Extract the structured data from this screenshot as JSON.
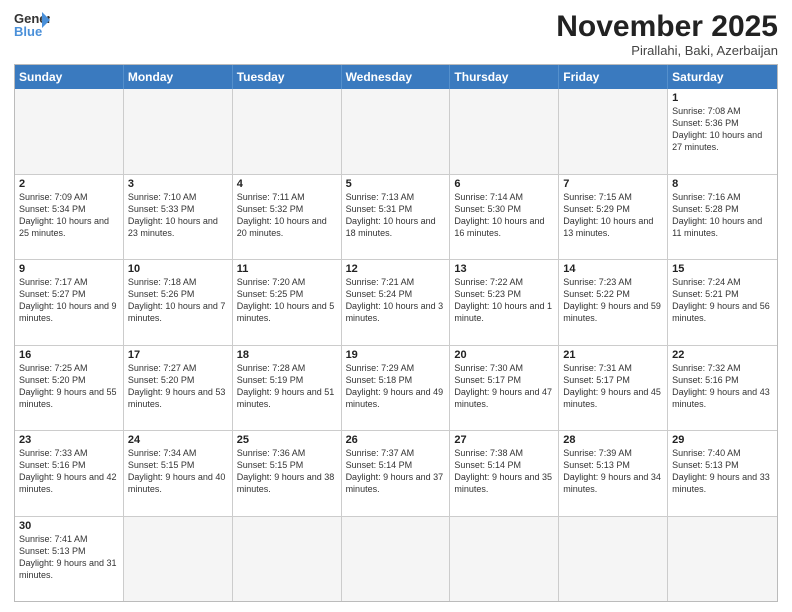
{
  "header": {
    "logo_general": "General",
    "logo_blue": "Blue",
    "month_title": "November 2025",
    "location": "Pirallahi, Baki, Azerbaijan"
  },
  "weekdays": [
    "Sunday",
    "Monday",
    "Tuesday",
    "Wednesday",
    "Thursday",
    "Friday",
    "Saturday"
  ],
  "rows": [
    [
      {
        "day": "",
        "info": ""
      },
      {
        "day": "",
        "info": ""
      },
      {
        "day": "",
        "info": ""
      },
      {
        "day": "",
        "info": ""
      },
      {
        "day": "",
        "info": ""
      },
      {
        "day": "",
        "info": ""
      },
      {
        "day": "1",
        "info": "Sunrise: 7:08 AM\nSunset: 5:36 PM\nDaylight: 10 hours and 27 minutes."
      }
    ],
    [
      {
        "day": "2",
        "info": "Sunrise: 7:09 AM\nSunset: 5:34 PM\nDaylight: 10 hours and 25 minutes."
      },
      {
        "day": "3",
        "info": "Sunrise: 7:10 AM\nSunset: 5:33 PM\nDaylight: 10 hours and 23 minutes."
      },
      {
        "day": "4",
        "info": "Sunrise: 7:11 AM\nSunset: 5:32 PM\nDaylight: 10 hours and 20 minutes."
      },
      {
        "day": "5",
        "info": "Sunrise: 7:13 AM\nSunset: 5:31 PM\nDaylight: 10 hours and 18 minutes."
      },
      {
        "day": "6",
        "info": "Sunrise: 7:14 AM\nSunset: 5:30 PM\nDaylight: 10 hours and 16 minutes."
      },
      {
        "day": "7",
        "info": "Sunrise: 7:15 AM\nSunset: 5:29 PM\nDaylight: 10 hours and 13 minutes."
      },
      {
        "day": "8",
        "info": "Sunrise: 7:16 AM\nSunset: 5:28 PM\nDaylight: 10 hours and 11 minutes."
      }
    ],
    [
      {
        "day": "9",
        "info": "Sunrise: 7:17 AM\nSunset: 5:27 PM\nDaylight: 10 hours and 9 minutes."
      },
      {
        "day": "10",
        "info": "Sunrise: 7:18 AM\nSunset: 5:26 PM\nDaylight: 10 hours and 7 minutes."
      },
      {
        "day": "11",
        "info": "Sunrise: 7:20 AM\nSunset: 5:25 PM\nDaylight: 10 hours and 5 minutes."
      },
      {
        "day": "12",
        "info": "Sunrise: 7:21 AM\nSunset: 5:24 PM\nDaylight: 10 hours and 3 minutes."
      },
      {
        "day": "13",
        "info": "Sunrise: 7:22 AM\nSunset: 5:23 PM\nDaylight: 10 hours and 1 minute."
      },
      {
        "day": "14",
        "info": "Sunrise: 7:23 AM\nSunset: 5:22 PM\nDaylight: 9 hours and 59 minutes."
      },
      {
        "day": "15",
        "info": "Sunrise: 7:24 AM\nSunset: 5:21 PM\nDaylight: 9 hours and 56 minutes."
      }
    ],
    [
      {
        "day": "16",
        "info": "Sunrise: 7:25 AM\nSunset: 5:20 PM\nDaylight: 9 hours and 55 minutes."
      },
      {
        "day": "17",
        "info": "Sunrise: 7:27 AM\nSunset: 5:20 PM\nDaylight: 9 hours and 53 minutes."
      },
      {
        "day": "18",
        "info": "Sunrise: 7:28 AM\nSunset: 5:19 PM\nDaylight: 9 hours and 51 minutes."
      },
      {
        "day": "19",
        "info": "Sunrise: 7:29 AM\nSunset: 5:18 PM\nDaylight: 9 hours and 49 minutes."
      },
      {
        "day": "20",
        "info": "Sunrise: 7:30 AM\nSunset: 5:17 PM\nDaylight: 9 hours and 47 minutes."
      },
      {
        "day": "21",
        "info": "Sunrise: 7:31 AM\nSunset: 5:17 PM\nDaylight: 9 hours and 45 minutes."
      },
      {
        "day": "22",
        "info": "Sunrise: 7:32 AM\nSunset: 5:16 PM\nDaylight: 9 hours and 43 minutes."
      }
    ],
    [
      {
        "day": "23",
        "info": "Sunrise: 7:33 AM\nSunset: 5:16 PM\nDaylight: 9 hours and 42 minutes."
      },
      {
        "day": "24",
        "info": "Sunrise: 7:34 AM\nSunset: 5:15 PM\nDaylight: 9 hours and 40 minutes."
      },
      {
        "day": "25",
        "info": "Sunrise: 7:36 AM\nSunset: 5:15 PM\nDaylight: 9 hours and 38 minutes."
      },
      {
        "day": "26",
        "info": "Sunrise: 7:37 AM\nSunset: 5:14 PM\nDaylight: 9 hours and 37 minutes."
      },
      {
        "day": "27",
        "info": "Sunrise: 7:38 AM\nSunset: 5:14 PM\nDaylight: 9 hours and 35 minutes."
      },
      {
        "day": "28",
        "info": "Sunrise: 7:39 AM\nSunset: 5:13 PM\nDaylight: 9 hours and 34 minutes."
      },
      {
        "day": "29",
        "info": "Sunrise: 7:40 AM\nSunset: 5:13 PM\nDaylight: 9 hours and 33 minutes."
      }
    ],
    [
      {
        "day": "30",
        "info": "Sunrise: 7:41 AM\nSunset: 5:13 PM\nDaylight: 9 hours and 31 minutes."
      },
      {
        "day": "",
        "info": ""
      },
      {
        "day": "",
        "info": ""
      },
      {
        "day": "",
        "info": ""
      },
      {
        "day": "",
        "info": ""
      },
      {
        "day": "",
        "info": ""
      },
      {
        "day": "",
        "info": ""
      }
    ]
  ]
}
